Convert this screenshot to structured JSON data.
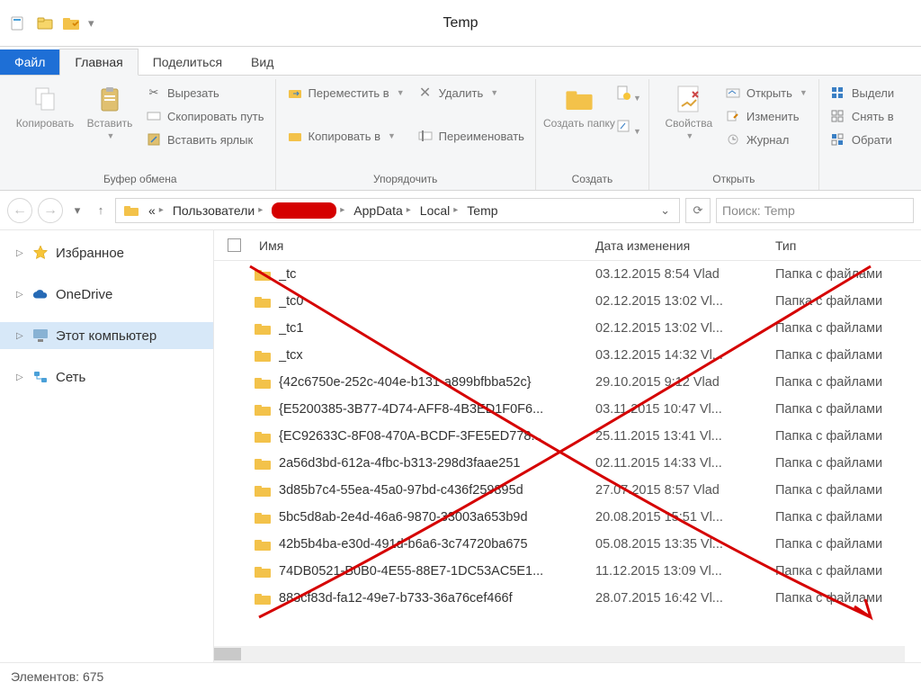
{
  "window": {
    "title": "Temp"
  },
  "tabs": {
    "file": "Файл",
    "home": "Главная",
    "share": "Поделиться",
    "view": "Вид"
  },
  "ribbon": {
    "clipboard": {
      "copy": "Копировать",
      "paste": "Вставить",
      "cut": "Вырезать",
      "copypath": "Скопировать путь",
      "shortcut": "Вставить ярлык",
      "label": "Буфер обмена"
    },
    "organize": {
      "moveto": "Переместить в",
      "copyto": "Копировать в",
      "delete": "Удалить",
      "rename": "Переименовать",
      "label": "Упорядочить"
    },
    "new": {
      "folder": "Создать папку",
      "label": "Создать"
    },
    "open": {
      "properties": "Свойства",
      "open": "Открыть",
      "edit": "Изменить",
      "history": "Журнал",
      "label": "Открыть"
    },
    "select": {
      "all": "Выдели",
      "none": "Снять в",
      "invert": "Обрати"
    }
  },
  "breadcrumbs": [
    "«",
    "Пользователи",
    "",
    "AppData",
    "Local",
    "Temp"
  ],
  "search": {
    "placeholder": "Поиск: Temp"
  },
  "nav": {
    "favorites": "Избранное",
    "onedrive": "OneDrive",
    "thispc": "Этот компьютер",
    "network": "Сеть"
  },
  "columns": {
    "name": "Имя",
    "date": "Дата изменения",
    "type": "Тип"
  },
  "rows": [
    {
      "name": "_tc",
      "date": "03.12.2015 8:54 Vlad",
      "type": "Папка с файлами"
    },
    {
      "name": "_tc0",
      "date": "02.12.2015 13:02 Vl...",
      "type": "Папка с файлами"
    },
    {
      "name": "_tc1",
      "date": "02.12.2015 13:02 Vl...",
      "type": "Папка с файлами"
    },
    {
      "name": "_tcx",
      "date": "03.12.2015 14:32 Vl...",
      "type": "Папка с файлами"
    },
    {
      "name": "{42c6750e-252c-404e-b131-a899bfbba52c}",
      "date": "29.10.2015 9:12 Vlad",
      "type": "Папка с файлами"
    },
    {
      "name": "{E5200385-3B77-4D74-AFF8-4B3ED1F0F6...",
      "date": "03.11.2015 10:47 Vl...",
      "type": "Папка с файлами"
    },
    {
      "name": "{EC92633C-8F08-470A-BCDF-3FE5ED778...",
      "date": "25.11.2015 13:41 Vl...",
      "type": "Папка с файлами"
    },
    {
      "name": "2a56d3bd-612a-4fbc-b313-298d3faae251",
      "date": "02.11.2015 14:33 Vl...",
      "type": "Папка с файлами"
    },
    {
      "name": "3d85b7c4-55ea-45a0-97bd-c436f259895d",
      "date": "27.07.2015 8:57 Vlad",
      "type": "Папка с файлами"
    },
    {
      "name": "5bc5d8ab-2e4d-46a6-9870-33003a653b9d",
      "date": "20.08.2015 15:51 Vl...",
      "type": "Папка с файлами"
    },
    {
      "name": "42b5b4ba-e30d-491d-b6a6-3c74720ba675",
      "date": "05.08.2015 13:35 Vl...",
      "type": "Папка с файлами"
    },
    {
      "name": "74DB0521-B0B0-4E55-88E7-1DC53AC5E1...",
      "date": "11.12.2015 13:09 Vl...",
      "type": "Папка с файлами"
    },
    {
      "name": "883cf83d-fa12-49e7-b733-36a76cef466f",
      "date": "28.07.2015 16:42 Vl...",
      "type": "Папка с файлами"
    }
  ],
  "status": {
    "items_label": "Элементов:",
    "count": "675"
  }
}
